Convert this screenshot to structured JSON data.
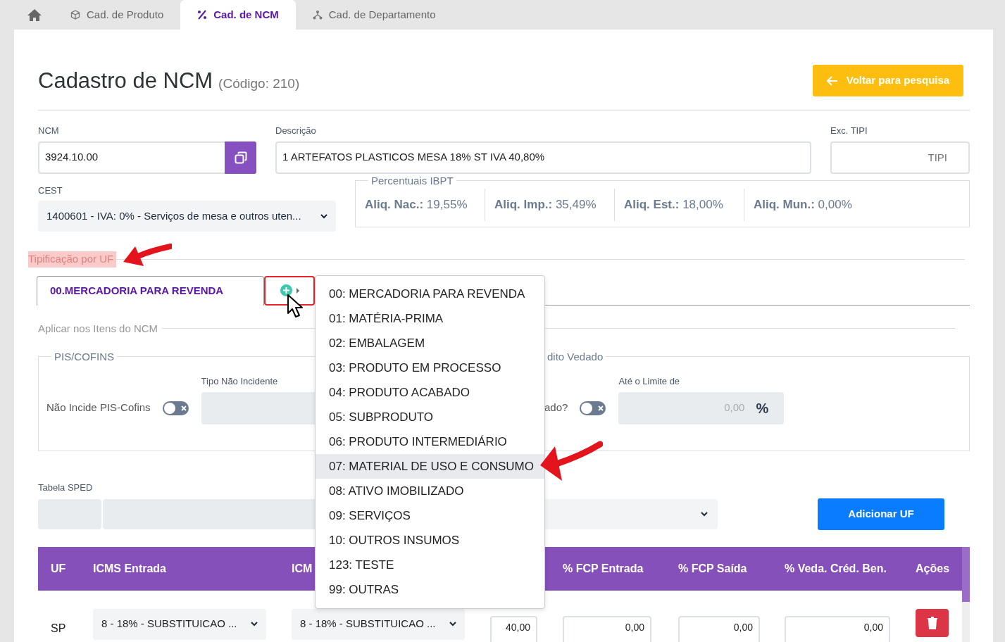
{
  "top_tabs": [
    {
      "kind": "home",
      "selected": false
    },
    {
      "kind": "box",
      "label": "Cad. de Produto",
      "selected": false
    },
    {
      "kind": "percent",
      "label": "Cad. de NCM",
      "selected": true
    },
    {
      "kind": "tree",
      "label": "Cad. de Departamento",
      "selected": false
    }
  ],
  "header": {
    "title": "Cadastro de NCM",
    "code": "(Código: 210)",
    "back_button": "Voltar para pesquisa"
  },
  "form": {
    "ncm": {
      "label": "NCM",
      "value": "3924.10.00"
    },
    "descricao": {
      "label": "Descrição",
      "value": "1 ARTEFATOS PLASTICOS MESA 18% ST IVA 40,80%"
    },
    "exc_tipi": {
      "label": "Exc. TIPI",
      "placeholder": "TIPI"
    },
    "cest": {
      "label": "CEST",
      "value": "1400601 - IVA: 0% - Serviços de mesa e outros uten..."
    },
    "ibpt": {
      "legend": "Percentuais IBPT",
      "items": [
        {
          "label": "Aliq. Nac.:",
          "value": "19,55%"
        },
        {
          "label": "Aliq. Imp.:",
          "value": "35,49%"
        },
        {
          "label": "Aliq. Est.:",
          "value": "18,00%"
        },
        {
          "label": "Aliq. Mun.:",
          "value": "0,00%"
        }
      ]
    }
  },
  "tipificacao": {
    "legend": "Tipificação por UF",
    "highlighted": true,
    "tabs": [
      {
        "label": "00.MERCADORIA PARA REVENDA",
        "selected": true
      }
    ],
    "add_button": {
      "highlighted": true
    },
    "menu": [
      {
        "label": "00: MERCADORIA PARA REVENDA",
        "hovered": false
      },
      {
        "label": "01: MATÉRIA-PRIMA",
        "hovered": false
      },
      {
        "label": "02: EMBALAGEM",
        "hovered": false
      },
      {
        "label": "03: PRODUTO EM PROCESSO",
        "hovered": false
      },
      {
        "label": "04: PRODUTO ACABADO",
        "hovered": false
      },
      {
        "label": "05: SUBPRODUTO",
        "hovered": false
      },
      {
        "label": "06: PRODUTO INTERMEDIÁRIO",
        "hovered": false
      },
      {
        "label": "07: MATERIAL DE USO E CONSUMO",
        "hovered": true
      },
      {
        "label": "08: ATIVO IMOBILIZADO",
        "hovered": false
      },
      {
        "label": "09: SERVIÇOS",
        "hovered": false
      },
      {
        "label": "10: OUTROS INSUMOS",
        "hovered": false
      },
      {
        "label": "123: TESTE",
        "hovered": false
      },
      {
        "label": "99: OUTRAS",
        "hovered": false
      }
    ]
  },
  "aplicar": {
    "legend": "Aplicar nos Itens do NCM",
    "pis_cofins": {
      "legend": "PIS/COFINS",
      "toggle_label": "Não Incide PIS-Cofins",
      "on": false,
      "field_label": "Tipo Não Incidente"
    },
    "credito": {
      "legend": "dito Vedado",
      "toggle_label": "ado?",
      "on": false,
      "limit_label": "Até o Limite de",
      "limit_value": "0,00",
      "unit": "%"
    }
  },
  "sped": {
    "label": "Tabela SPED",
    "button": "Adicionar UF"
  },
  "table": {
    "columns": [
      "UF",
      "ICMS Entrada",
      "ICM",
      "% FCP Entrada",
      "% FCP Saída",
      "% Veda. Créd. Ben.",
      "Ações"
    ],
    "rows": [
      {
        "uf": "SP",
        "icms_entrada": "8 - 18% - SUBSTITUICAO ...",
        "icms_saida": "8 - 18% - SUBSTITUICAO ...",
        "column_4": "40,00",
        "fcp_entrada": "0,00",
        "fcp_saida": "0,00",
        "veda": "0,00"
      }
    ]
  }
}
